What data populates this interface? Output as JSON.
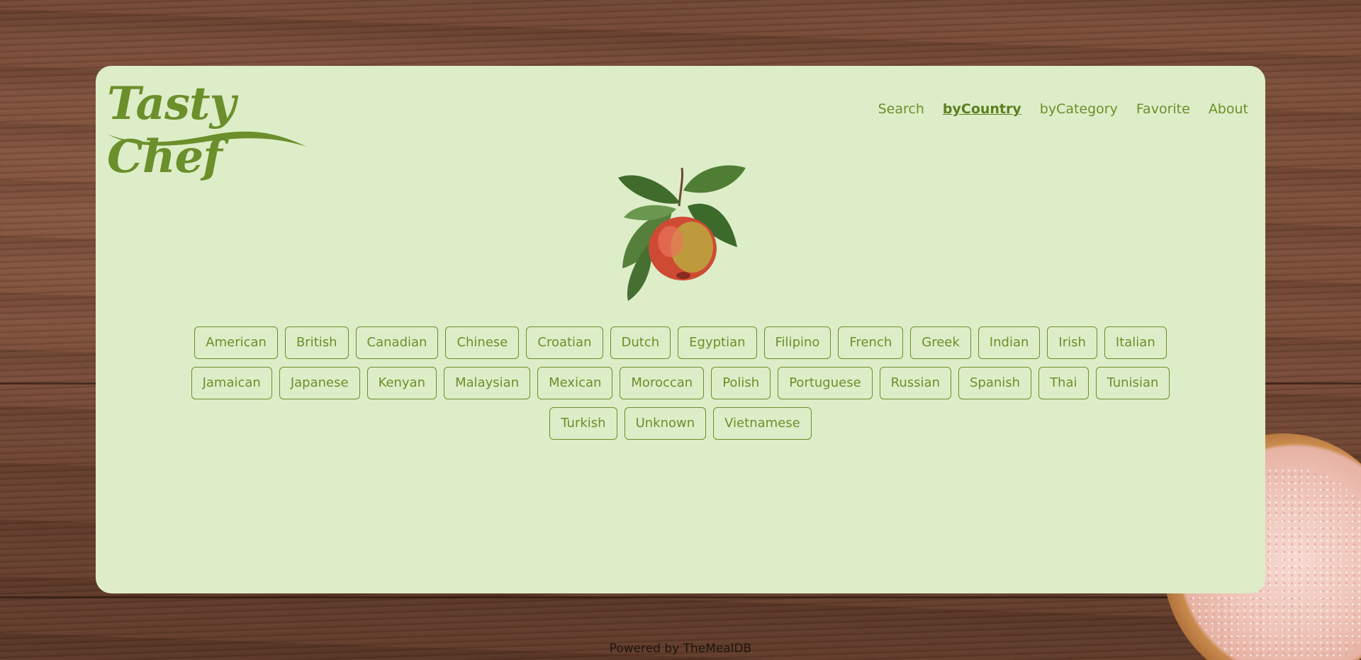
{
  "header": {
    "logo_text": "Tasty Chef",
    "nav": [
      {
        "label": "Search",
        "active": false
      },
      {
        "label": "byCountry",
        "active": true
      },
      {
        "label": "byCategory",
        "active": false
      },
      {
        "label": "Favorite",
        "active": false
      },
      {
        "label": "About",
        "active": false
      }
    ]
  },
  "hero": {
    "image": "apple-illustration"
  },
  "areas": [
    "American",
    "British",
    "Canadian",
    "Chinese",
    "Croatian",
    "Dutch",
    "Egyptian",
    "Filipino",
    "French",
    "Greek",
    "Indian",
    "Irish",
    "Italian",
    "Jamaican",
    "Japanese",
    "Kenyan",
    "Malaysian",
    "Mexican",
    "Moroccan",
    "Polish",
    "Portuguese",
    "Russian",
    "Spanish",
    "Thai",
    "Tunisian",
    "Turkish",
    "Unknown",
    "Vietnamese"
  ],
  "footer": {
    "text": "Powered by TheMealDB"
  },
  "colors": {
    "accent": "#6b8f2a",
    "panel": "#ddedc8",
    "wood": "#6e4533"
  }
}
